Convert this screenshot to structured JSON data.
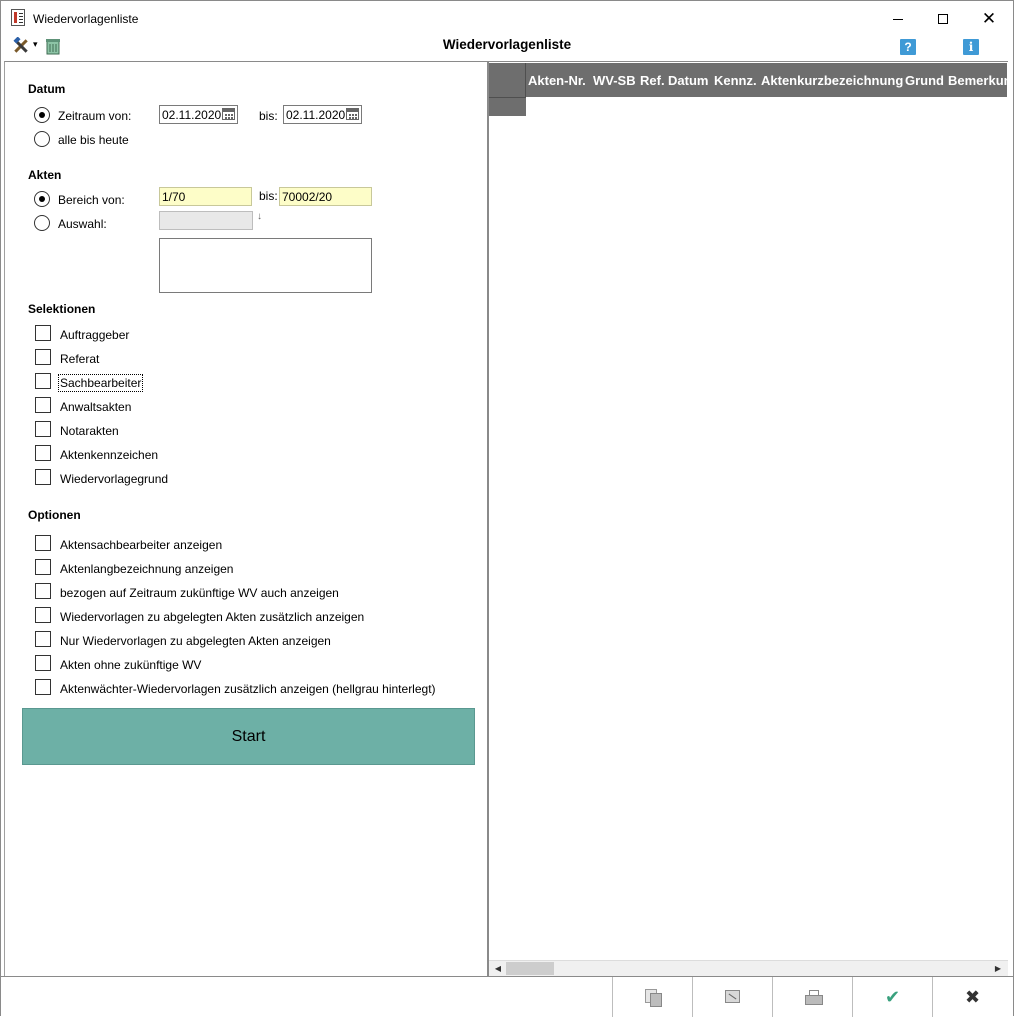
{
  "window": {
    "title": "Wiedervorlagenliste",
    "minimize_glyph": "",
    "maximize_glyph": "",
    "close_glyph": "✕"
  },
  "toolbar": {
    "page_title": "Wiedervorlagenliste",
    "dropdown_glyph": "▾",
    "help_glyph": "?",
    "info_glyph": "i"
  },
  "datum": {
    "heading": "Datum",
    "zeitraum_label": "Zeitraum von:",
    "von_value": "02.11.2020",
    "bis_label": "bis:",
    "bis_value": "02.11.2020",
    "alle_label": "alle bis heute",
    "selected": "zeitraum"
  },
  "akten": {
    "heading": "Akten",
    "bereich_label": "Bereich von:",
    "von_value": "1/70",
    "bis_label": "bis:",
    "bis_value": "70002/20",
    "auswahl_label": "Auswahl:",
    "auswahl_value": "",
    "arrow_glyph": "↓",
    "selected": "bereich"
  },
  "selektionen": {
    "heading": "Selektionen",
    "items": [
      {
        "label": "Auftraggeber",
        "checked": false
      },
      {
        "label": "Referat",
        "checked": false
      },
      {
        "label": "Sachbearbeiter",
        "checked": false
      },
      {
        "label": "Anwaltsakten",
        "checked": false
      },
      {
        "label": "Notarakten",
        "checked": false
      },
      {
        "label": "Aktenkennzeichen",
        "checked": false
      },
      {
        "label": "Wiedervorlagegrund",
        "checked": false
      }
    ]
  },
  "optionen": {
    "heading": "Optionen",
    "items": [
      {
        "label": "Aktensachbearbeiter anzeigen",
        "checked": false
      },
      {
        "label": "Aktenlangbezeichnung anzeigen",
        "checked": false
      },
      {
        "label": "bezogen auf Zeitraum zukünftige WV auch anzeigen",
        "checked": false
      },
      {
        "label": "Wiedervorlagen zu abgelegten Akten zusätzlich anzeigen",
        "checked": false
      },
      {
        "label": "Nur Wiedervorlagen zu abgelegten Akten anzeigen",
        "checked": false
      },
      {
        "label": "Akten ohne zukünftige WV",
        "checked": false
      },
      {
        "label": "Aktenwächter-Wiedervorlagen zusätzlich anzeigen (hellgrau hinterlegt)",
        "checked": false
      }
    ]
  },
  "start_button": {
    "label": "Start"
  },
  "grid": {
    "columns": [
      "Akten-Nr.",
      "WV-SB",
      "Ref.",
      "Datum",
      "Kennz.",
      "Aktenkurzbezeichnung",
      "Grund",
      "Bemerkung"
    ],
    "rows": []
  },
  "scrollbar": {
    "left_glyph": "◀",
    "right_glyph": "▶"
  },
  "bottom_bar": {
    "ok_glyph": "✔",
    "cancel_glyph": "✖"
  },
  "colors": {
    "start_button_bg": "#6db0a6",
    "grid_header_bg": "#6e6e6e",
    "input_highlight_bg": "#fdfdc8",
    "ok_icon": "#3aa17e",
    "help_icon_bg": "#3f9ad6"
  }
}
